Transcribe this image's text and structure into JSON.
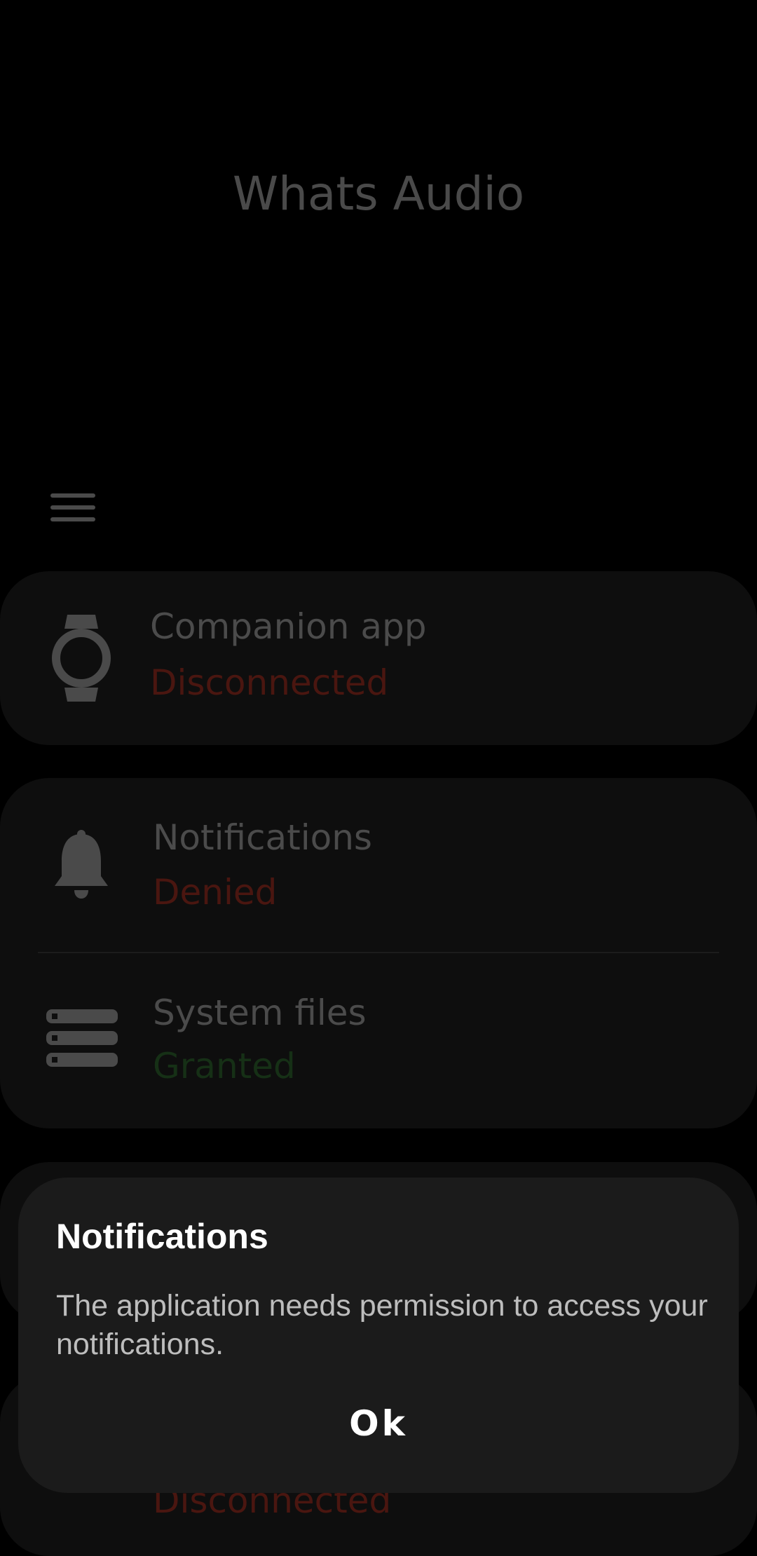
{
  "app": {
    "title": "Whats Audio"
  },
  "header": {
    "menu_icon": "hamburger-menu-icon"
  },
  "status_cards": [
    {
      "icon": "smartwatch-icon",
      "title": "Companion app",
      "status": "Disconnected",
      "status_color": "#4a1610"
    }
  ],
  "permissions_card": {
    "items": [
      {
        "icon": "bell-icon",
        "title": "Notifications",
        "status": "Denied",
        "status_color": "#4a1610"
      },
      {
        "icon": "storage-icon",
        "title": "System files",
        "status": "Granted",
        "status_color": "#163016"
      }
    ]
  },
  "dialog": {
    "title": "Notifications",
    "message": "The application needs permission to access your notifications.",
    "ok_label": "Ok"
  },
  "colors": {
    "background": "#000000",
    "card": "#0e0e0e",
    "dialog": "#1b1b1b",
    "denied": "#4a1610",
    "granted": "#163016"
  }
}
